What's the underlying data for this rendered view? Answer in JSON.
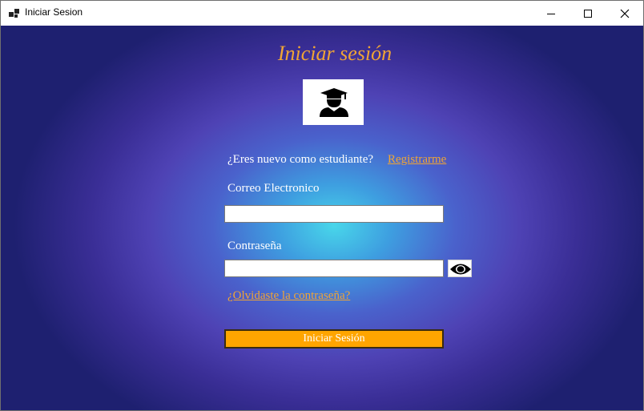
{
  "window": {
    "title": "Iniciar Sesion",
    "app_icon": "app-window-icon",
    "controls": [
      "minimize-icon",
      "maximize-icon",
      "close-icon"
    ]
  },
  "form": {
    "heading": "Iniciar sesión",
    "logo_icon": "graduate-student-icon",
    "new_student_prompt": "¿Eres nuevo como estudiante?",
    "register_link": "Registrarme",
    "email_label": "Correo Electronico",
    "email_value": "",
    "password_label": "Contraseña",
    "password_value": "",
    "show_password_icon": "eye-icon",
    "forgot_password_link": "¿Olvidaste la contraseña?",
    "submit_label": "Iniciar Sesión"
  },
  "colors": {
    "accent": "#f0a535",
    "button": "#ffa500",
    "background_center": "#48d6ea",
    "background_edge": "#1e2070"
  }
}
